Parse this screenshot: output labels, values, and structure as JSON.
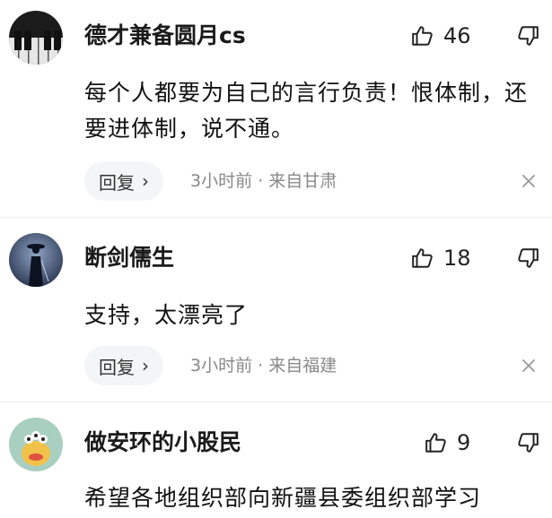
{
  "comments": [
    {
      "username": "德才兼备圆月cs",
      "avatar": "piano-keys-avatar",
      "like_count": "46",
      "content": "每个人都要为自己的言行负责！恨体制，还要进体制，说不通。",
      "reply_label": "回复",
      "time": "3小时前",
      "separator": "·",
      "location": "来自甘肃"
    },
    {
      "username": "断剑儒生",
      "avatar": "swordsman-silhouette-avatar",
      "like_count": "18",
      "content": "支持，太漂亮了",
      "reply_label": "回复",
      "time": "3小时前",
      "separator": "·",
      "location": "来自福建"
    },
    {
      "username": "做安环的小股民",
      "avatar": "green-monster-avatar",
      "like_count": "9",
      "content": "希望各地组织部向新疆县委组织部学习"
    }
  ],
  "icons": {
    "like": "thumbs-up-icon",
    "dislike": "thumbs-down-icon",
    "close": "close-icon",
    "chevron": "chevron-right-icon"
  },
  "colors": {
    "text": "#111111",
    "meta": "#888888",
    "reply_bg": "#f4f5f6",
    "divider": "#ededed"
  }
}
